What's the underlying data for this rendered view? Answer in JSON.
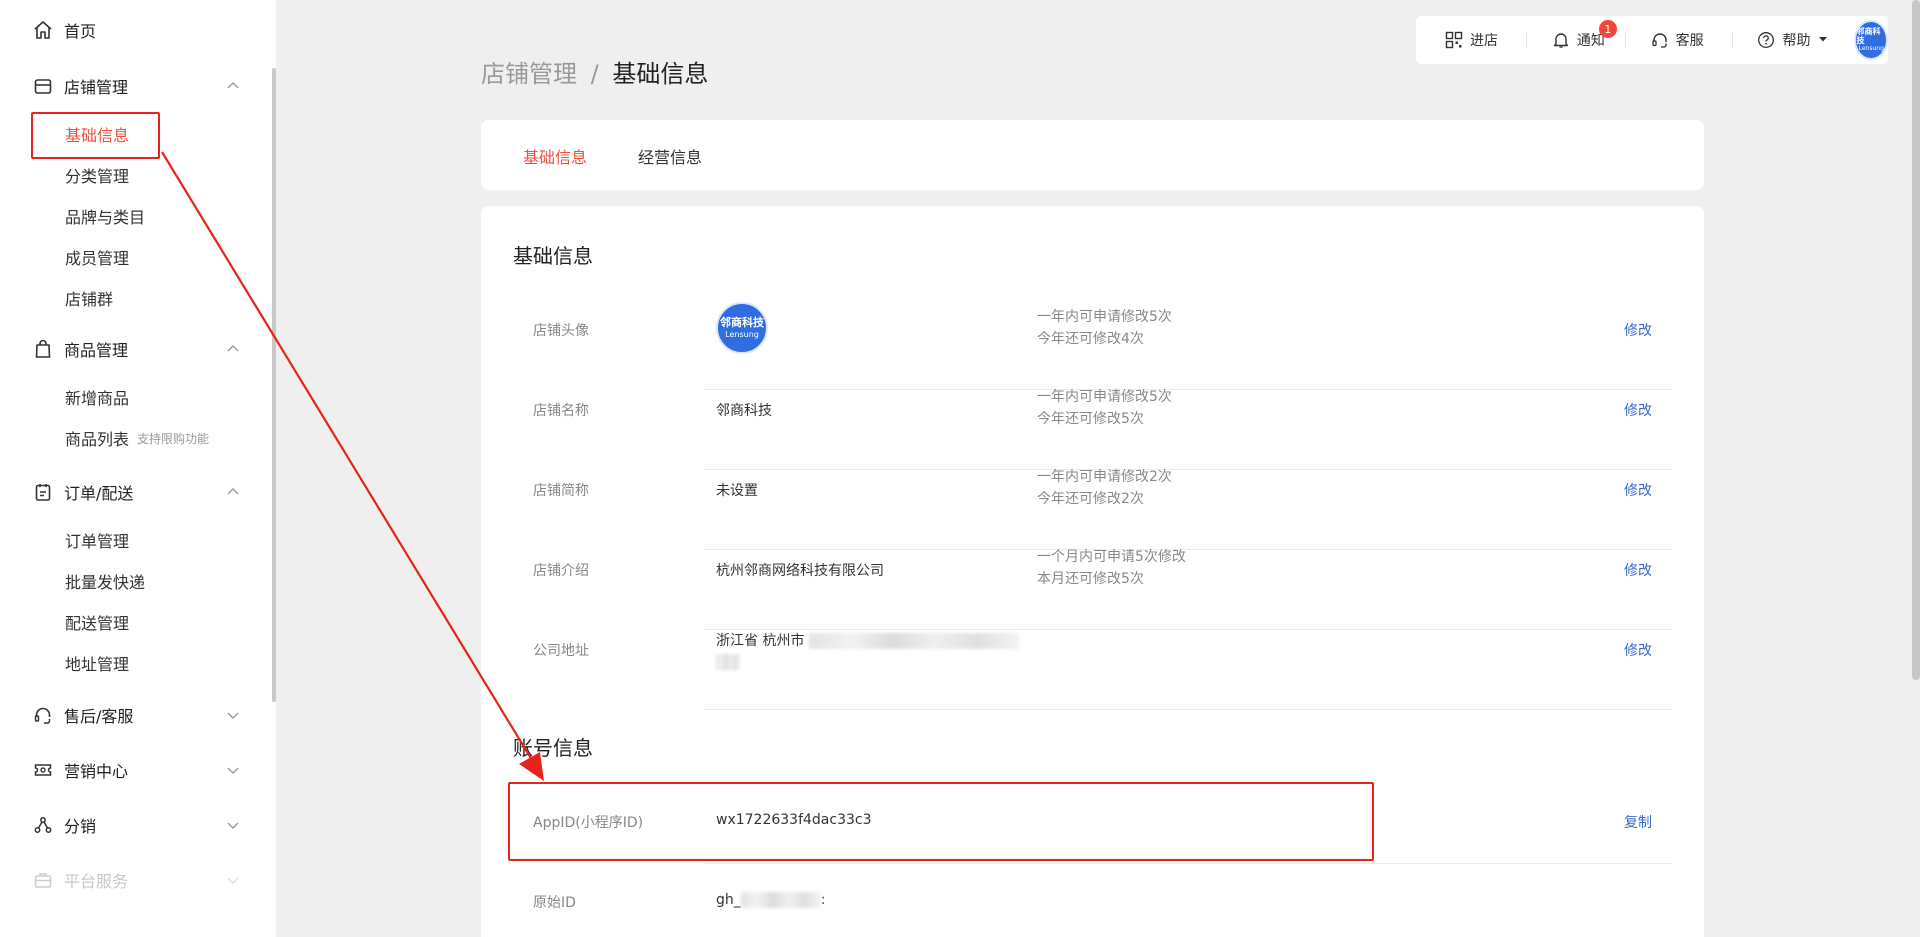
{
  "sidebar": {
    "home": "首页",
    "store": {
      "label": "店铺管理",
      "items": [
        "基础信息",
        "分类管理",
        "品牌与类目",
        "成员管理",
        "店铺群"
      ]
    },
    "goods": {
      "label": "商品管理",
      "items": [
        "新增商品",
        "商品列表"
      ],
      "list_note": "支持限购功能"
    },
    "orders": {
      "label": "订单/配送",
      "items": [
        "订单管理",
        "批量发快递",
        "配送管理",
        "地址管理"
      ]
    },
    "after_sales": "售后/客服",
    "marketing": "营销中心",
    "distribution": "分销",
    "platform": "平台服务"
  },
  "topbar": {
    "enter_store": "进店",
    "notify": "通知",
    "notify_count": "1",
    "service": "客服",
    "help": "帮助",
    "avatar_line1": "邻商科技",
    "avatar_line2": "Lensung"
  },
  "breadcrumb": {
    "parent": "店铺管理",
    "sep": "/",
    "current": "基础信息"
  },
  "tabs": [
    "基础信息",
    "经营信息"
  ],
  "basic_section": {
    "title": "基础信息",
    "rows": [
      {
        "label": "店铺头像",
        "value": "",
        "note1": "一年内可申请修改5次",
        "note2": "今年还可修改4次",
        "action": "修改"
      },
      {
        "label": "店铺名称",
        "value": "邻商科技",
        "note1": "一年内可申请修改5次",
        "note2": "今年还可修改5次",
        "action": "修改"
      },
      {
        "label": "店铺简称",
        "value": "未设置",
        "note1": "一年内可申请修改2次",
        "note2": "今年还可修改2次",
        "action": "修改"
      },
      {
        "label": "店铺介绍",
        "value": "杭州邻商网络科技有限公司",
        "note1": "一个月内可申请5次修改",
        "note2": "本月还可修改5次",
        "action": "修改"
      },
      {
        "label": "公司地址",
        "value": "浙江省 杭州市",
        "note1": "",
        "note2": "",
        "action": "修改"
      }
    ],
    "avatar_line1": "邻商科技",
    "avatar_line2": "Lensung"
  },
  "account_section": {
    "title": "账号信息",
    "rows": [
      {
        "label": "AppID(小程序ID)",
        "value": "wx1722633f4dac33c3",
        "action": "复制"
      },
      {
        "label": "原始ID",
        "value": "gh_",
        "suffix": ":"
      }
    ]
  },
  "colors": {
    "accent": "#f0503c",
    "link": "#3a6bc4",
    "annotation": "#e8231a",
    "brand_blue": "#2f6de1"
  }
}
